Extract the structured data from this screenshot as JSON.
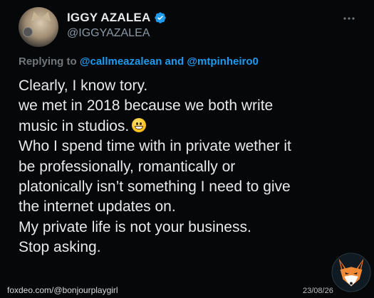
{
  "tweet": {
    "display_name": "IGGY AZALEA",
    "handle": "@IGGYAZALEA",
    "more_icon": "more-horizontal-icon",
    "verified_icon": "verified-badge-icon",
    "replying_prefix": "Replying to",
    "replying_mention_1": "@callmeazalean",
    "replying_and": "and",
    "replying_mention_2": "@mtpinheiro0",
    "body_lines": [
      "Clearly, I know tory.",
      "we met in 2018 because we both write",
      "music in studios.",
      "Who I spend time with in private wether it",
      "be professionally, romantically or",
      "platonically isn’t something I need to give",
      "the internet updates on.",
      "My private life is not your business.",
      "Stop asking."
    ],
    "emoji_icon": "grinning-face-emoji-icon"
  },
  "watermark": {
    "source": "foxdeo.com/@bonjourplaygirl",
    "date": "23/08/26",
    "logo_icon": "fox-logo-icon"
  },
  "colors": {
    "background": "#060708",
    "text": "#e7e9ea",
    "secondary": "#71767b",
    "link": "#1d9bf0",
    "verified": "#1d9bf0"
  }
}
